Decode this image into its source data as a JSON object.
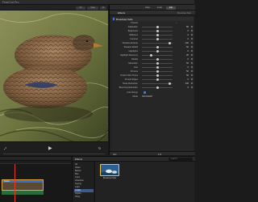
{
  "app": {
    "title": "Final Cut Pro"
  },
  "viewer_toolbar": {
    "zoom": "Fit",
    "view": "View"
  },
  "inspector": {
    "tabs": [
      "Video",
      "Audio",
      "Info"
    ],
    "clip_title": "Effects",
    "clip_sub": "Broadcast Safe",
    "effect_name": "Broadcast Safe",
    "presets_label": "Presets",
    "params": [
      {
        "label": "Adaptation",
        "value": "50",
        "knob": 0.5
      },
      {
        "label": "Brightness",
        "value": "0",
        "knob": 0.5
      },
      {
        "label": "Midtones",
        "value": "0",
        "knob": 0.5
      },
      {
        "label": "Contrast",
        "value": "0",
        "knob": 0.5
      },
      {
        "label": "Shadow Exclude",
        "value": "100",
        "knob": 0.9
      },
      {
        "label": "Shadow Rolloff",
        "value": "50",
        "knob": 0.5
      },
      {
        "label": "Highlights",
        "value": "0",
        "knob": 0.5
      },
      {
        "label": "Highlight Recovery",
        "value": "25",
        "knob": 0.3
      },
      {
        "label": "Details",
        "value": "0",
        "knob": 0.5
      },
      {
        "label": "Saturation",
        "value": "50",
        "knob": 0.5
      },
      {
        "label": "Hue",
        "value": "0",
        "knob": 0.5
      },
      {
        "label": "Chroma",
        "value": "50",
        "knob": 0.5
      },
      {
        "label": "Protect Skin Tones",
        "value": "50",
        "knob": 0.5
      },
      {
        "label": "Protect Edges",
        "value": "0",
        "knob": 0.5
      },
      {
        "label": "Noise Reduction",
        "value": "100",
        "knob": 0.9
      },
      {
        "label": "Blooming Reduction",
        "value": "0",
        "knob": 0.5
      }
    ],
    "auto_range_label": "Auto Range",
    "mode_label": "Mode",
    "mode_value": "Soft Rolloff",
    "mix_label": "Mix",
    "mix_value": "1.0"
  },
  "timeline": {
    "clip_label": "Ducks"
  },
  "effects_browser": {
    "title": "Effects",
    "search_placeholder": "Search",
    "categories": [
      "All",
      "Video",
      "Basics",
      "Blur",
      "Color",
      "Distortion",
      "Keying",
      "Light",
      "Looks",
      "Stylize",
      "Tiling"
    ],
    "selected_category": 8,
    "thumb_label": "Broadcast Safe"
  }
}
